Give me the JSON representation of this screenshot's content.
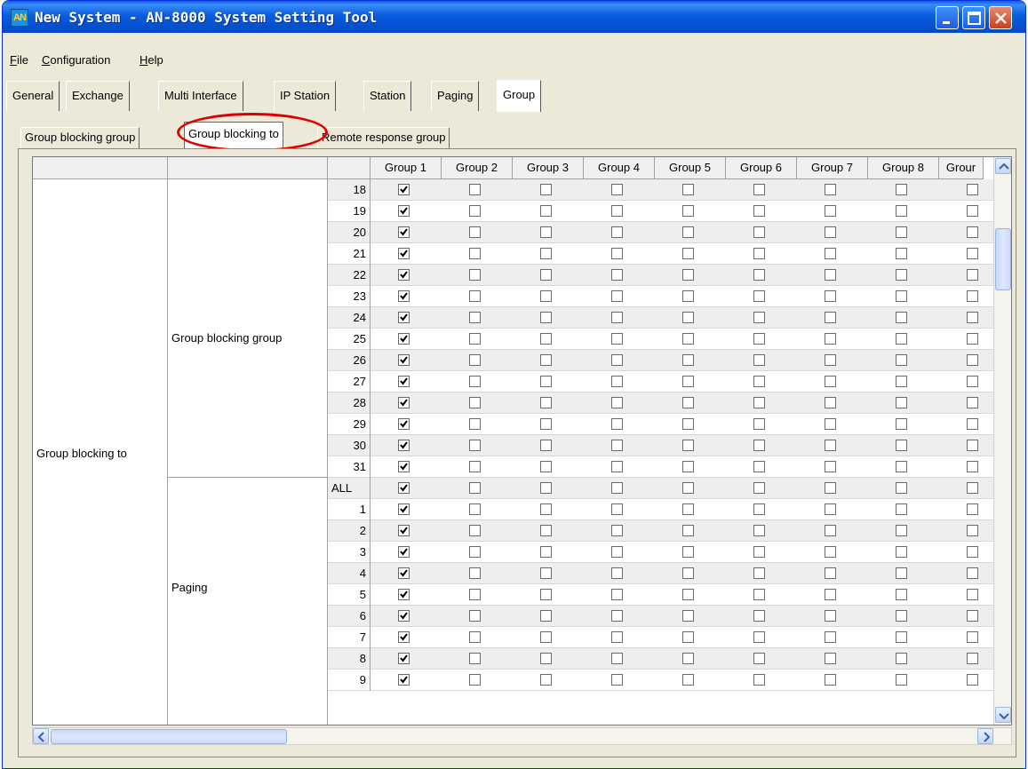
{
  "window": {
    "title": "New System - AN-8000 System Setting Tool",
    "icon_text": "AN"
  },
  "menu": [
    {
      "label": "File"
    },
    {
      "label": "Configuration"
    },
    {
      "label": "Help"
    }
  ],
  "top_tabs": [
    "General",
    "Exchange",
    "Multi Interface",
    "IP Station",
    "Station",
    "Paging",
    "Group"
  ],
  "top_tabs_active": "Group",
  "sub_tabs": [
    "Group blocking group",
    "Group blocking to",
    "Remote response group"
  ],
  "sub_tabs_active": "Group blocking to",
  "grid": {
    "columns": [
      "Group 1",
      "Group 2",
      "Group 3",
      "Group 4",
      "Group 5",
      "Group 6",
      "Group 7",
      "Group 8",
      "Grour"
    ],
    "section_label": "Group blocking to",
    "groups": [
      {
        "label": "Group blocking group",
        "rows": [
          "18",
          "19",
          "20",
          "21",
          "22",
          "23",
          "24",
          "25",
          "26",
          "27",
          "28",
          "29",
          "30",
          "31"
        ]
      },
      {
        "label": "Paging",
        "rows": [
          "ALL",
          "1",
          "2",
          "3",
          "4",
          "5",
          "6",
          "7",
          "8",
          "9"
        ]
      }
    ],
    "checked_column": "Group 1"
  },
  "colors": {
    "title_bar": "#0a5de0",
    "highlight": "#e00000",
    "window_bg": "#ece9d8"
  },
  "icons": [
    "minimize-icon",
    "maximize-icon",
    "close-icon",
    "scroll-up-icon",
    "scroll-down-icon",
    "scroll-left-icon",
    "scroll-right-icon",
    "checkbox-check-icon"
  ]
}
